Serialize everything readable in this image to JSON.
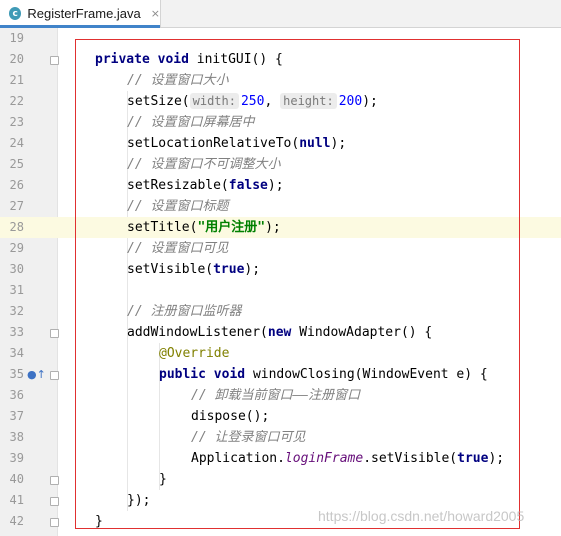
{
  "tab": {
    "icon": "java-class-icon",
    "title": "RegisterFrame.java",
    "close": "×"
  },
  "lines": [
    {
      "n": "19"
    },
    {
      "n": "20"
    },
    {
      "n": "21"
    },
    {
      "n": "22"
    },
    {
      "n": "23"
    },
    {
      "n": "24"
    },
    {
      "n": "25"
    },
    {
      "n": "26"
    },
    {
      "n": "27"
    },
    {
      "n": "28"
    },
    {
      "n": "29"
    },
    {
      "n": "30"
    },
    {
      "n": "31"
    },
    {
      "n": "32"
    },
    {
      "n": "33"
    },
    {
      "n": "34"
    },
    {
      "n": "35"
    },
    {
      "n": "36"
    },
    {
      "n": "37"
    },
    {
      "n": "38"
    },
    {
      "n": "39"
    },
    {
      "n": "40"
    },
    {
      "n": "41"
    },
    {
      "n": "42"
    }
  ],
  "code": {
    "l20": {
      "kw1": "private",
      "kw2": "void",
      "rest": "initGUI() {"
    },
    "l21": "// 设置窗口大小",
    "l22": {
      "fn": "setSize(",
      "hint1": "width:",
      "v1": "250",
      "sep": ",",
      "hint2": "height:",
      "v2": "200",
      "end": ");"
    },
    "l23": "// 设置窗口屏幕居中",
    "l24": {
      "fn": "setLocationRelativeTo(",
      "kw": "null",
      "end": ");"
    },
    "l25": "// 设置窗口不可调整大小",
    "l26": {
      "fn": "setResizable(",
      "kw": "false",
      "end": ");"
    },
    "l27": "// 设置窗口标题",
    "l28": {
      "fn": "setTitle(",
      "str": "\"用户注册\"",
      "end": ");"
    },
    "l29": "// 设置窗口可见",
    "l30": {
      "fn": "setVisible(",
      "kw": "true",
      "end": ");"
    },
    "l32": "// 注册窗口监听器",
    "l33": {
      "fn": "addWindowListener(",
      "kw": "new",
      "rest": "WindowAdapter() {"
    },
    "l34": "@Override",
    "l35": {
      "kw1": "public",
      "kw2": "void",
      "rest": "windowClosing(WindowEvent e) {"
    },
    "l36": "// 卸载当前窗口——注册窗口",
    "l37": "dispose();",
    "l38": "// 让登录窗口可见",
    "l39": {
      "cls": "Application.",
      "fld": "loginFrame",
      "mid": ".setVisible(",
      "kw": "true",
      "end": ");"
    },
    "l40": "}",
    "l41": "});",
    "l42": "}"
  },
  "watermark": "https://blog.csdn.net/howard2005",
  "colors": {
    "highlight": "#fcfae1",
    "box": "#e03030",
    "keyword": "#000080",
    "comment": "#808080",
    "string": "#008000"
  }
}
